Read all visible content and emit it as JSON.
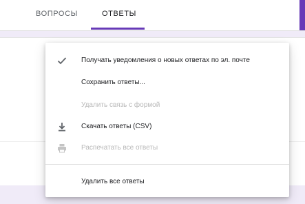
{
  "tabs": {
    "questions_label": "ВОПРОСЫ",
    "responses_label": "ОТВЕТЫ",
    "active": "responses"
  },
  "menu": {
    "items": [
      {
        "label": "Получать уведомления о новых ответах по эл. почте",
        "icon": "check-icon",
        "enabled": true,
        "checked": true
      },
      {
        "label": "Сохранить ответы...",
        "icon": "",
        "enabled": true
      },
      {
        "label": "Удалить связь с формой",
        "icon": "",
        "enabled": false
      },
      {
        "label": "Скачать ответы (CSV)",
        "icon": "download-icon",
        "enabled": true
      },
      {
        "label": "Распечатать все ответы",
        "icon": "print-icon",
        "enabled": false
      },
      {
        "label": "Удалить все ответы",
        "icon": "",
        "enabled": true
      }
    ]
  },
  "colors": {
    "accent": "#673ab7",
    "background": "#f0ebf8",
    "text_primary": "#202124",
    "text_disabled": "#b8b8b8"
  }
}
